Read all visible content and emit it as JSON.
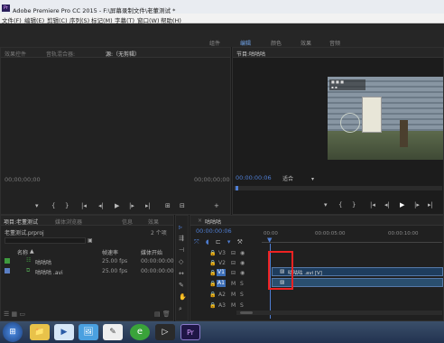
{
  "window": {
    "title": "Adobe Premiere Pro CC 2015 - F:\\屏幕录制文件\\老董测试 *"
  },
  "menu": [
    "文件(F)",
    "编辑(E)",
    "剪辑(C)",
    "序列(S)",
    "标记(M)",
    "字幕(T)",
    "窗口(W)",
    "帮助(H)"
  ],
  "workspaces": [
    "组件",
    "编辑",
    "颜色",
    "效果",
    "音频"
  ],
  "source": {
    "tabs": [
      "效果控件",
      "音轨混合器:",
      "源:（无剪辑）"
    ],
    "timecode_left": "00;00;00;00",
    "timecode_right": "00;00;00;00",
    "controls": [
      "▾",
      "{",
      "}",
      "|◂",
      "◂|",
      "▶",
      "|▸",
      "▸|",
      "⊞",
      "⊟",
      "+"
    ]
  },
  "program": {
    "title": "节目:咕咕咕",
    "timecode": "00:00:00:06",
    "fit": "适合",
    "hud_lines": [
      "■ ■ ■",
      "▪ ▪"
    ],
    "controls": [
      "▾",
      "{",
      "}",
      "|◂",
      "◂|",
      "▶",
      "|▸",
      "▸|",
      "⊞",
      "⊟",
      "+"
    ]
  },
  "project": {
    "tabs": [
      "项目:老董测试",
      "媒体浏览器",
      "信息",
      "效果"
    ],
    "file": "老董测试.prproj",
    "item_count": "2 个项",
    "columns": [
      "名称",
      "帧速率",
      "媒体开始"
    ],
    "items": [
      {
        "name": "咕咕咕",
        "fps": "25.00 fps",
        "start": "00:00:00:00",
        "color": "#3f9a3f"
      },
      {
        "name": "咕咕咕 .avi",
        "fps": "25.00 fps",
        "start": "00:00:00:00",
        "color": "#5b7fc4"
      }
    ]
  },
  "timeline": {
    "seq": "咕咕咕",
    "timecode": "00:00:00:06",
    "ruler": [
      "00:00",
      "00:00:05:00",
      "00:00:10:00"
    ],
    "tracks": [
      {
        "id": "V3"
      },
      {
        "id": "V2"
      },
      {
        "id": "V1"
      },
      {
        "id": "A1"
      },
      {
        "id": "A2"
      },
      {
        "id": "A3"
      }
    ],
    "video_clip_label": "咕咕咕 .avi [V]"
  },
  "taskbar": {
    "start_glyph": "⊞",
    "items": [
      "📁",
      "▶",
      "🖼",
      "✎",
      "e",
      "▷",
      "Pr"
    ]
  }
}
